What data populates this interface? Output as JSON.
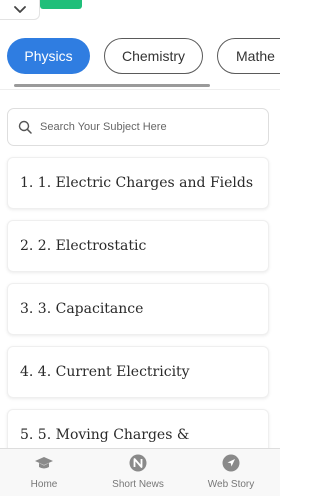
{
  "header": {
    "collapse_icon": "chevron-down-icon",
    "accent_color": "#1fbf7a"
  },
  "tabs": [
    {
      "label": "Physics",
      "active": true
    },
    {
      "label": "Chemistry",
      "active": false
    },
    {
      "label": "Mathe",
      "active": false
    }
  ],
  "search": {
    "placeholder": "Search Your Subject Here",
    "icon": "search-icon"
  },
  "chapters": [
    {
      "label": "1. 1. Electric Charges and Fields"
    },
    {
      "label": "2. 2. Electrostatic"
    },
    {
      "label": "3. 3. Capacitance"
    },
    {
      "label": "4. 4. Current Electricity"
    },
    {
      "label": "5. 5. Moving Charges &"
    }
  ],
  "bottom_nav": [
    {
      "label": "Home",
      "icon": "graduation-cap-icon"
    },
    {
      "label": "Short News",
      "icon": "news-icon"
    },
    {
      "label": "Web Story",
      "icon": "navigation-arrow-icon"
    }
  ],
  "colors": {
    "active_tab": "#2f7de1"
  }
}
